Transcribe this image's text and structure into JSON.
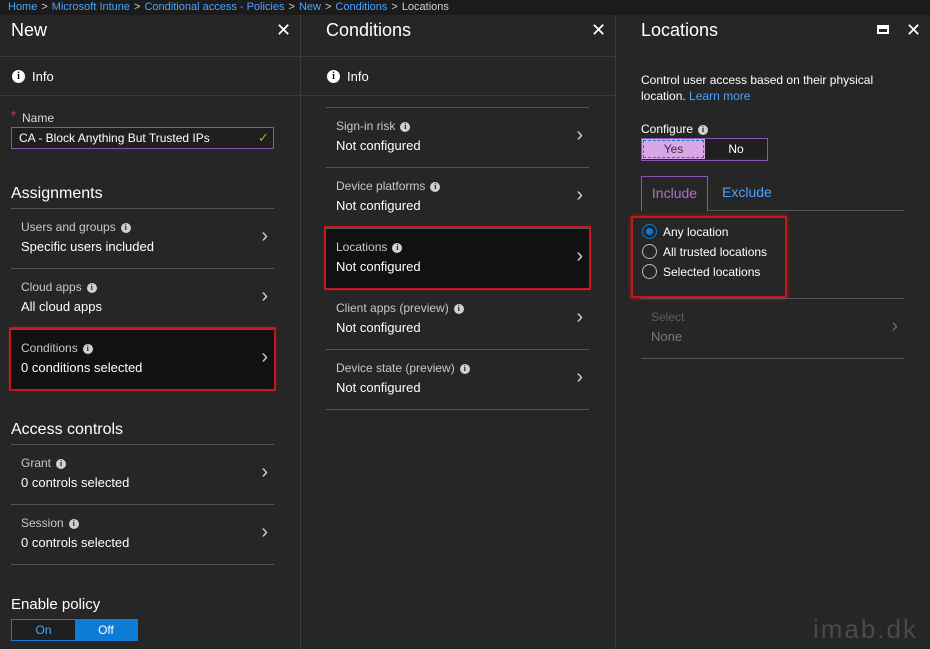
{
  "breadcrumb": {
    "items": [
      "Home",
      "Microsoft Intune",
      "Conditional access - Policies",
      "New",
      "Conditions"
    ],
    "current": "Locations"
  },
  "blade_new": {
    "title": "New",
    "info": "Info",
    "name_label": "Name",
    "name_value": "CA - Block Anything But Trusted IPs",
    "assignments_heading": "Assignments",
    "assignments": [
      {
        "label": "Users and groups",
        "value": "Specific users included"
      },
      {
        "label": "Cloud apps",
        "value": "All cloud apps"
      },
      {
        "label": "Conditions",
        "value": "0 conditions selected"
      }
    ],
    "access_heading": "Access controls",
    "access": [
      {
        "label": "Grant",
        "value": "0 controls selected"
      },
      {
        "label": "Session",
        "value": "0 controls selected"
      }
    ],
    "enable_heading": "Enable policy",
    "toggle_on": "On",
    "toggle_off": "Off"
  },
  "blade_conditions": {
    "title": "Conditions",
    "info": "Info",
    "rows": [
      {
        "label": "Sign-in risk",
        "value": "Not configured"
      },
      {
        "label": "Device platforms",
        "value": "Not configured"
      },
      {
        "label": "Locations",
        "value": "Not configured"
      },
      {
        "label": "Client apps (preview)",
        "value": "Not configured"
      },
      {
        "label": "Device state (preview)",
        "value": "Not configured"
      }
    ]
  },
  "blade_locations": {
    "title": "Locations",
    "description": "Control user access based on their physical location.",
    "learn_more": "Learn more",
    "configure_label": "Configure",
    "yes": "Yes",
    "no": "No",
    "tab_include": "Include",
    "tab_exclude": "Exclude",
    "options": [
      "Any location",
      "All trusted locations",
      "Selected locations"
    ],
    "select_label": "Select",
    "select_value": "None"
  },
  "watermark": "imab.dk",
  "colors": {
    "accent": "#0e7bd6",
    "highlight": "#c4161c",
    "selected_yes": "#d9a6e8",
    "link": "#4aa3ff"
  }
}
